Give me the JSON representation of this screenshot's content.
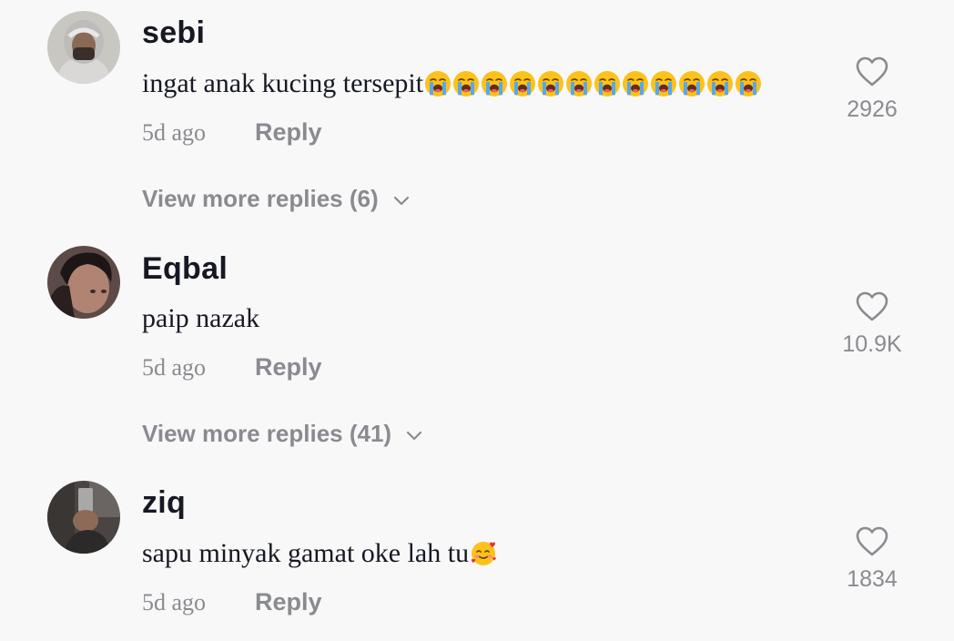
{
  "comments": [
    {
      "username": "sebi",
      "text": "ingat anak kucing tersepit",
      "emoji": [
        "loudly-crying-face",
        "loudly-crying-face",
        "loudly-crying-face",
        "loudly-crying-face",
        "loudly-crying-face",
        "loudly-crying-face",
        "loudly-crying-face",
        "loudly-crying-face",
        "loudly-crying-face",
        "loudly-crying-face",
        "loudly-crying-face",
        "loudly-crying-face"
      ],
      "date": "5d ago",
      "reply_label": "Reply",
      "like_count": "2926",
      "view_more": "View more replies (6)"
    },
    {
      "username": "Eqbal",
      "text": "paip nazak",
      "emoji": [],
      "date": "5d ago",
      "reply_label": "Reply",
      "like_count": "10.9K",
      "view_more": "View more replies (41)"
    },
    {
      "username": "ziq",
      "text": "sapu minyak gamat oke lah tu",
      "emoji": [
        "smiling-face-with-hearts"
      ],
      "date": "5d ago",
      "reply_label": "Reply",
      "like_count": "1834"
    }
  ],
  "icons": {
    "like": "heart-outline-icon",
    "expand": "chevron-down-icon"
  },
  "colors": {
    "background": "#f8f8f8",
    "primary_text": "#161823",
    "secondary_text": "#8a8b91"
  }
}
